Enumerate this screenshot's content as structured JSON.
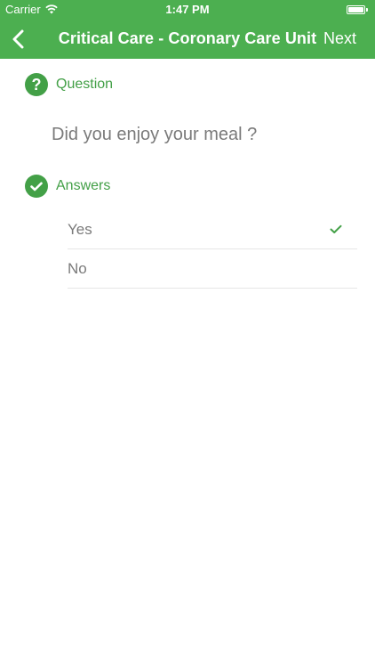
{
  "status_bar": {
    "carrier": "Carrier",
    "time": "1:47 PM",
    "battery_level": 1.0
  },
  "nav": {
    "back_icon": "chevron-left-icon",
    "title": "Critical Care - Coronary Care Unit",
    "next_label": "Next"
  },
  "question_section": {
    "icon": "question-circle-icon",
    "label": "Question",
    "text": "Did you enjoy your meal ?"
  },
  "answers_section": {
    "icon": "check-circle-icon",
    "label": "Answers",
    "items": [
      {
        "label": "Yes",
        "selected": true
      },
      {
        "label": "No",
        "selected": false
      }
    ]
  },
  "colors": {
    "accent": "#4caf50",
    "text_muted": "#7a7a7a"
  }
}
